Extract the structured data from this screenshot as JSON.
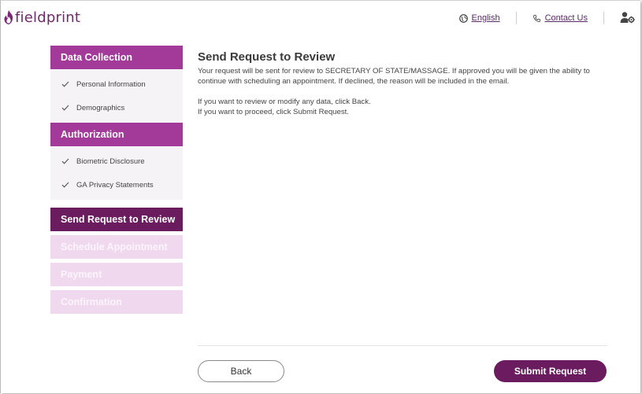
{
  "header": {
    "logo_text": "fieldprint",
    "language_label": "English",
    "contact_label": "Contact Us"
  },
  "sidebar": {
    "sections": [
      {
        "title": "Data Collection",
        "items": [
          "Personal Information",
          "Demographics"
        ]
      },
      {
        "title": "Authorization",
        "items": [
          "Biometric Disclosure",
          "GA Privacy Statements"
        ]
      }
    ],
    "steps": {
      "active": "Send Request to Review",
      "upcoming": [
        "Schedule Appointment",
        "Payment",
        "Confirmation"
      ]
    }
  },
  "main": {
    "title": "Send Request to Review",
    "paragraph1": "Your request will be sent for review to SECRETARY OF STATE/MASSAGE. If approved you will be given the ability to continue with scheduling an appointment. If declined, the reason will be included in the email.",
    "line1": "If you want to review or modify any data, click Back.",
    "line2": "If you want to proceed, click Submit Request."
  },
  "footer": {
    "back_label": "Back",
    "submit_label": "Submit Request"
  },
  "colors": {
    "brand_purple": "#a33a99",
    "active_step": "#6b1c5f",
    "disabled_step": "#f0d9ee"
  }
}
